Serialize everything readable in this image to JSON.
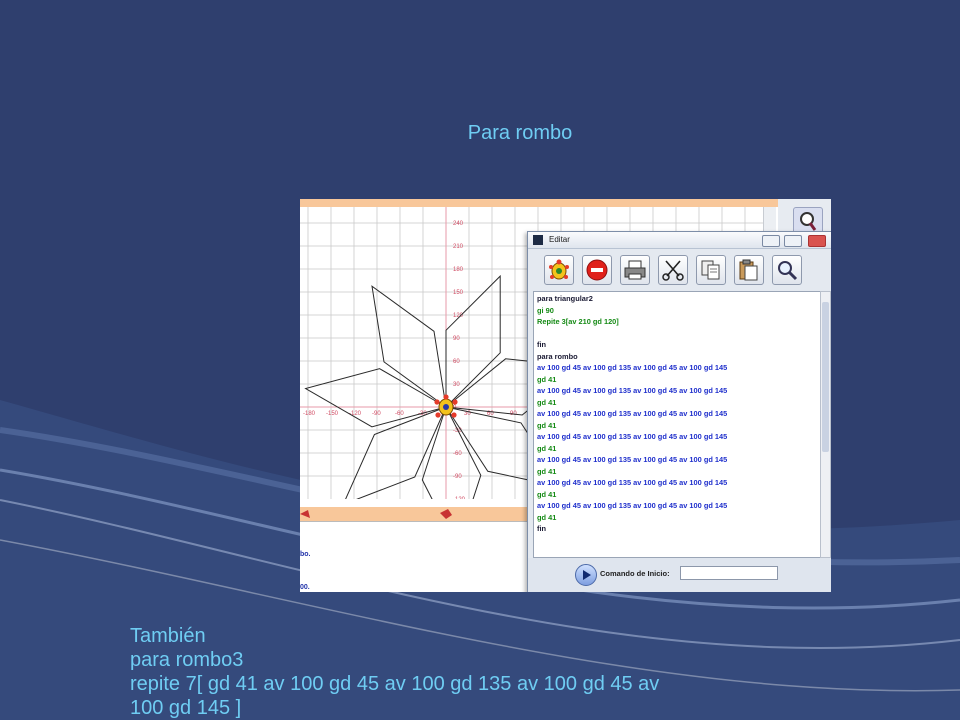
{
  "slide": {
    "title": "Para rombo",
    "bottom_lines": [
      "También",
      "para rombo3",
      "repite 7[  gd 41 av 100 gd 45 av 100 gd 135 av 100 gd  45 av",
      "100 gd 145 ]"
    ]
  },
  "grid": {
    "y_ticks": [
      "270",
      "240",
      "210",
      "180",
      "150",
      "120",
      "90",
      "60",
      "30",
      "0",
      "-30",
      "-60",
      "-90",
      "-120"
    ],
    "x_ticks": [
      "-180",
      "-150",
      "-120",
      "-90",
      "-60",
      "-30",
      "0",
      "30",
      "60",
      "90"
    ]
  },
  "console": {
    "lines": [
      "bo.",
      "00."
    ]
  },
  "editor": {
    "title": "Editar",
    "tools": [
      "turtle-icon",
      "stop-icon",
      "print-icon",
      "scissors-icon",
      "copy-icon",
      "paste-icon",
      "zoom-icon"
    ],
    "code": [
      {
        "text": "para triangular2",
        "color": "dark"
      },
      {
        "text": "gi 90",
        "color": "green"
      },
      {
        "text": "Repite 3[av 210 gd 120]",
        "color": "green"
      },
      {
        "text": "",
        "color": "dark"
      },
      {
        "text": "fin",
        "color": "dark"
      },
      {
        "text": "para rombo",
        "color": "dark"
      },
      {
        "text": "av 100 gd 45 av 100 gd 135 av 100 gd  45 av 100 gd 145",
        "color": "blue"
      },
      {
        "text": "gd 41",
        "color": "green"
      },
      {
        "text": "av 100 gd 45 av 100 gd 135 av 100 gd  45 av 100 gd 145",
        "color": "blue"
      },
      {
        "text": "gd 41",
        "color": "green"
      },
      {
        "text": "av 100 gd 45 av 100 gd 135 av 100 gd  45 av 100 gd 145",
        "color": "blue"
      },
      {
        "text": "gd 41",
        "color": "green"
      },
      {
        "text": "av 100 gd 45 av 100 gd 135 av 100 gd  45 av 100 gd 145",
        "color": "blue"
      },
      {
        "text": "gd 41",
        "color": "green"
      },
      {
        "text": "av 100 gd 45 av 100 gd 135 av 100 gd  45 av 100 gd 145",
        "color": "blue"
      },
      {
        "text": "gd 41",
        "color": "green"
      },
      {
        "text": "av 100 gd 45 av 100 gd 135 av 100 gd  45 av 100 gd 145",
        "color": "blue"
      },
      {
        "text": "gd 41",
        "color": "green"
      },
      {
        "text": "av 100 gd 45 av 100 gd 135 av 100 gd  45 av 100 gd 145",
        "color": "blue"
      },
      {
        "text": "gd 41",
        "color": "green"
      },
      {
        "text": "fin",
        "color": "dark"
      }
    ],
    "command_label": "Comando de Inicio:",
    "command_value": ""
  },
  "colors": {
    "background": "#2f3f6e",
    "accent_text": "#6fcdf3",
    "peach_strip": "#f8c79a"
  }
}
